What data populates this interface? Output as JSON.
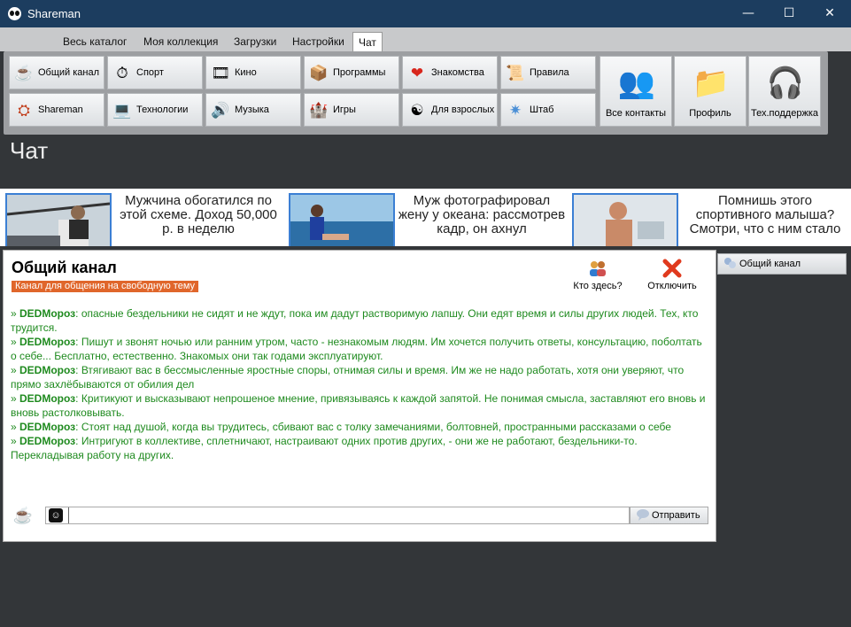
{
  "window": {
    "title": "Shareman",
    "minimize": "—",
    "maximize": "☐",
    "close": "✕"
  },
  "menu": {
    "tabs": [
      {
        "label": "Весь каталог"
      },
      {
        "label": "Моя коллекция"
      },
      {
        "label": "Загрузки"
      },
      {
        "label": "Настройки"
      },
      {
        "label": "Чат",
        "active": true
      }
    ]
  },
  "ribbon": {
    "buttons": [
      {
        "label": "Общий канал",
        "icon": "☕"
      },
      {
        "label": "Спорт",
        "icon": "⏱"
      },
      {
        "label": "Кино",
        "icon": "🎞"
      },
      {
        "label": "Программы",
        "icon": "📦"
      },
      {
        "label": "Знакомства",
        "icon": "❤"
      },
      {
        "label": "Правила",
        "icon": "📜"
      },
      {
        "label": "Shareman",
        "icon": "⛭"
      },
      {
        "label": "Технологии",
        "icon": "💻"
      },
      {
        "label": "Музыка",
        "icon": "🔊"
      },
      {
        "label": "Игры",
        "icon": "🏰"
      },
      {
        "label": "Для взрослых",
        "icon": "☯"
      },
      {
        "label": "Штаб",
        "icon": "✷"
      }
    ],
    "large": [
      {
        "label": "Все контакты",
        "icon": "👥"
      },
      {
        "label": "Профиль",
        "icon": "📁"
      },
      {
        "label": "Тех.поддержка",
        "icon": "🎧"
      }
    ]
  },
  "page": {
    "title": "Чат"
  },
  "ads": [
    {
      "text": "Мужчина обогатился по этой схеме. Доход 50,000 р. в неделю"
    },
    {
      "text": "Муж фотографировал жену у океана: рассмотрев кадр, он ахнул"
    },
    {
      "text": "Помнишь этого спортивного малыша? Смотри, что с ним стало"
    }
  ],
  "channel": {
    "title": "Общий канал",
    "subtitle": "Канал для общения на свободную тему",
    "who_here": "Кто здесь?",
    "disconnect": "Отключить"
  },
  "messages": [
    {
      "author": "DEDМороз",
      "text": "опасные бездельники не сидят и не ждут, пока им дадут растворимую лапшу. Они едят время и силы других людей. Тех, кто трудится."
    },
    {
      "author": "DEDМороз",
      "text": "Пишут и звонят ночью или ранним утром, часто - незнакомым людям. Им хочется получить ответы, консультацию, поболтать о себе... Бесплатно, естественно. Знакомых они так годами эксплуатируют."
    },
    {
      "author": "DEDМороз",
      "text": "Втягивают вас в бессмысленные яростные споры, отнимая силы и время. Им же не надо работать, хотя они уверяют, что прямо захлёбываются от обилия дел"
    },
    {
      "author": "DEDМороз",
      "text": "Критикуют и высказывают непрошеное мнение, привязываясь к каждой запятой. Не понимая смысла, заставляют его вновь и вновь растолковывать."
    },
    {
      "author": "DEDМороз",
      "text": "Стоят над душой, когда вы трудитесь, сбивают вас с толку замечаниями, болтовней, пространными рассказами о себе"
    },
    {
      "author": "DEDМороз",
      "text": "Интригуют в коллективе, сплетничают, настраивают одних против других, - они же не работают, бездельники-то. Перекладывая работу на других."
    }
  ],
  "composer": {
    "value": "",
    "send_label": "Отправить"
  },
  "channels_list": [
    {
      "label": "Общий канал"
    }
  ]
}
